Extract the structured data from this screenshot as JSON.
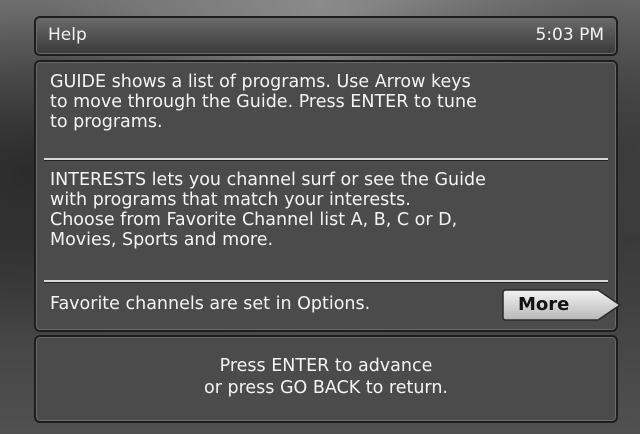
{
  "header": {
    "title": "Help",
    "time": "5:03 PM"
  },
  "content": {
    "guide_text": "GUIDE shows a list of programs.  Use Arrow keys\nto move through the Guide.  Press ENTER to tune\nto programs.",
    "interests_text": "INTERESTS lets you channel surf or see the Guide\nwith programs that match your interests.\nChoose from Favorite Channel list A, B, C or D,\nMovies, Sports and more.",
    "favorites_note": "Favorite channels are set in Options.",
    "more_label": "More"
  },
  "footer": {
    "instructions": "Press ENTER to advance\nor press GO BACK to return."
  }
}
